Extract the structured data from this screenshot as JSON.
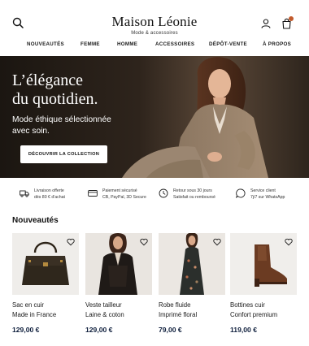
{
  "header": {
    "brand": "Maison Léonie",
    "tagline": "Mode & accessoires"
  },
  "nav": [
    "NOUVEAUTÉS",
    "FEMME",
    "HOMME",
    "ACCESSOIRES",
    "DÉPÔT-VENTE",
    "À PROPOS"
  ],
  "hero": {
    "title_line1": "L’élégance",
    "title_line2": "du quotidien.",
    "subtitle_line1": "Mode éthique sélectionnée",
    "subtitle_line2": "avec soin.",
    "cta": "DÉCOUVRIR LA COLLECTION"
  },
  "features": [
    {
      "icon": "truck-icon",
      "line1": "Livraison offerte",
      "line2": "dès 80 € d'achat"
    },
    {
      "icon": "card-icon",
      "line1": "Paiement sécurisé",
      "line2": "CB, PayPal, 3D Secure"
    },
    {
      "icon": "clock-icon",
      "line1": "Retour sous 30 jours",
      "line2": "Satisfait ou remboursé"
    },
    {
      "icon": "chat-icon",
      "line1": "Service client",
      "line2": "7j/7 sur WhatsApp"
    }
  ],
  "section": {
    "title": "Nouveautés"
  },
  "products": [
    {
      "line1": "Sac en cuir",
      "line2": "Made in France",
      "price": "129,00 €"
    },
    {
      "line1": "Veste tailleur",
      "line2": "Laine & coton",
      "price": "129,00 €"
    },
    {
      "line1": "Robe fluide",
      "line2": "Imprimé floral",
      "price": "79,00 €"
    },
    {
      "line1": "Bottines cuir",
      "line2": "Confort premium",
      "price": "119,00 €"
    }
  ],
  "colors": {
    "accent": "#c25a2c",
    "price": "#0f1f3d",
    "hero_bg": "#2a211a"
  }
}
